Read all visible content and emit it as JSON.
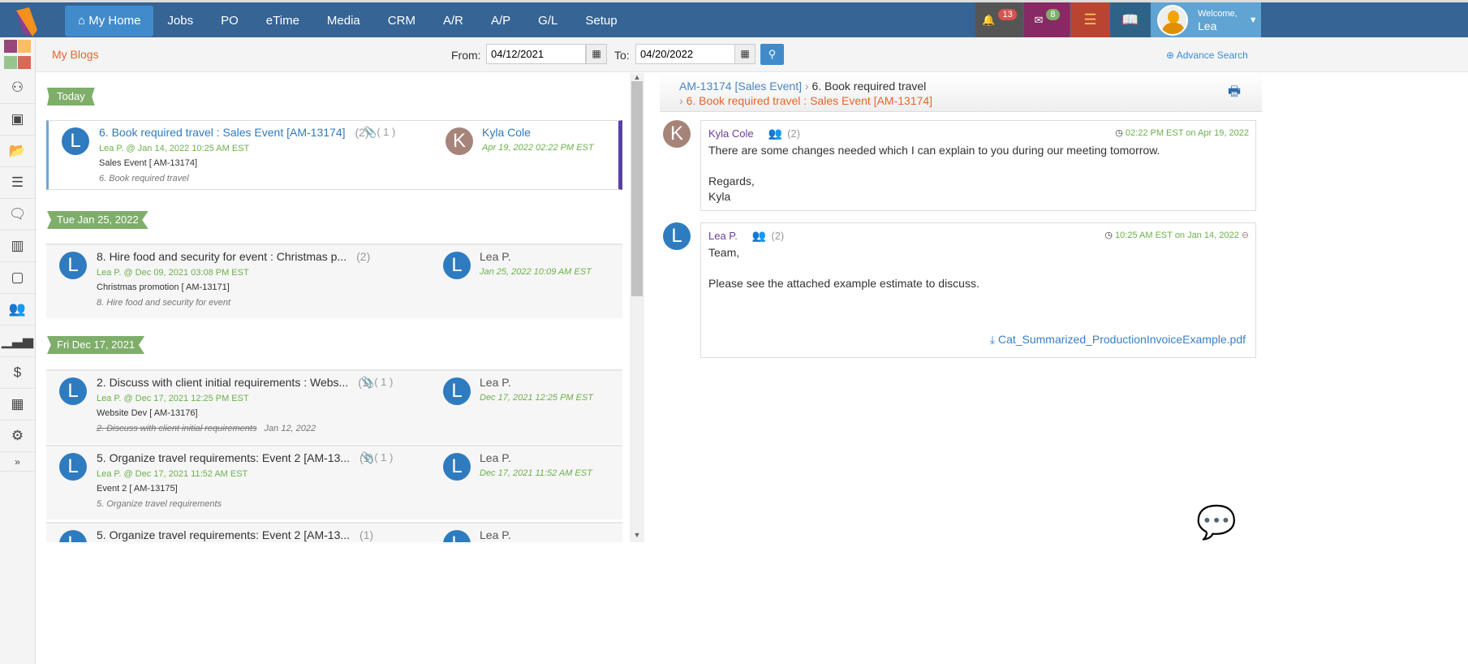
{
  "nav": {
    "items": [
      "My Home",
      "Jobs",
      "PO",
      "eTime",
      "Media",
      "CRM",
      "A/R",
      "A/P",
      "G/L",
      "Setup"
    ],
    "active": "My Home"
  },
  "toolbar": {
    "notifications": "13",
    "messages": "8",
    "welcome": "Welcome,",
    "user": "Lea"
  },
  "colors": {
    "topbar": "#366494",
    "active": "#428bca",
    "notify_bg": "#555555",
    "mail_bg": "#872a63",
    "coins_bg": "#b94432",
    "book_bg": "#2e6387",
    "user_bg": "#5fa4d2",
    "ribbon": "#7fae6b"
  },
  "sidebar": {
    "icons": [
      "apps-grid-icon",
      "org-chart-icon",
      "image-icon",
      "folder-open-icon",
      "server-icon",
      "comments-icon",
      "map-icon",
      "calendar-icon",
      "users-icon",
      "signal-icon",
      "money-icon",
      "calendar-grid-icon",
      "cogs-icon",
      "expand-icon"
    ]
  },
  "header": {
    "title": "My Blogs",
    "from_label": "From:",
    "from": "04/12/2021",
    "to_label": "To:",
    "to": "04/20/2022",
    "advance_search": "Advance Search"
  },
  "groups": [
    {
      "label": "Today",
      "items": [
        {
          "title": "6. Book required travel : Sales Event [AM-13174]",
          "count": "(2)",
          "attach": "( 1 )",
          "by": "Lea P. @ Jan 14, 2022 10:25 AM EST",
          "project": "Sales Event [ AM-13174]",
          "task": "6. Book required travel",
          "due": "",
          "reply_name": "Kyla Cole",
          "reply_date": "Apr 19, 2022 02:22 PM EST",
          "avatar": "L",
          "reply_avatar": "K"
        }
      ]
    },
    {
      "label": "Tue Jan 25, 2022",
      "items": [
        {
          "title": "8. Hire food and security for event : Christmas p...",
          "count": "(2)",
          "attach": "",
          "by": "Lea P. @ Dec 09, 2021 03:08 PM EST",
          "project": "Christmas promotion [ AM-13171]",
          "task": "8. Hire food and security for event",
          "due": "",
          "reply_name": "Lea P.",
          "reply_date": "Jan 25, 2022 10:09 AM EST",
          "avatar": "L",
          "reply_avatar": "L"
        }
      ]
    },
    {
      "label": "Fri Dec 17, 2021",
      "items": [
        {
          "title": "2. Discuss with client initial requirements : Webs...",
          "count": "(1)",
          "attach": "( 1 )",
          "by": "Lea P. @ Dec 17, 2021 12:25 PM EST",
          "project": "Website Dev [ AM-13176]",
          "task": "2. Discuss with client initial requirements",
          "due": "Jan 12, 2022",
          "reply_name": "Lea P.",
          "reply_date": "Dec 17, 2021 12:25 PM EST",
          "avatar": "L",
          "reply_avatar": "L"
        },
        {
          "title": "5. Organize travel requirements: Event 2 [AM-13...",
          "count": "(1)",
          "attach": "( 1 )",
          "by": "Lea P. @ Dec 17, 2021 11:52 AM EST",
          "project": "Event 2 [ AM-13175]",
          "task": "5. Organize travel requirements",
          "due": "",
          "reply_name": "Lea P.",
          "reply_date": "Dec 17, 2021 11:52 AM EST",
          "avatar": "L",
          "reply_avatar": "L"
        },
        {
          "title": "5. Organize travel requirements: Event 2 [AM-13...",
          "count": "(1)",
          "attach": "",
          "by": "",
          "project": "",
          "task": "",
          "due": "",
          "reply_name": "Lea P.",
          "reply_date": "",
          "avatar": "L",
          "reply_avatar": "L"
        }
      ]
    }
  ],
  "detail": {
    "crumb_project": "AM-13174 [Sales Event]",
    "crumb_task": "6. Book required travel",
    "crumb_current": "6. Book required travel : Sales Event [AM-13174]",
    "messages": [
      {
        "avatar": "K",
        "name": "Kyla Cole",
        "count": "(2)",
        "time": "02:22 PM EST on Apr 19, 2022",
        "lines": [
          "There are some changes needed which I can explain to you during our meeting tomorrow.",
          "",
          "Regards,",
          "Kyla"
        ],
        "attachment": ""
      },
      {
        "avatar": "L",
        "name": "Lea P.",
        "count": "(2)",
        "time": "10:25 AM EST on Jan 14, 2022",
        "lines": [
          "Team,",
          "",
          "Please see the attached example estimate to discuss.",
          "",
          ""
        ],
        "attachment": "Cat_Summarized_ProductionInvoiceExample.pdf"
      }
    ]
  }
}
